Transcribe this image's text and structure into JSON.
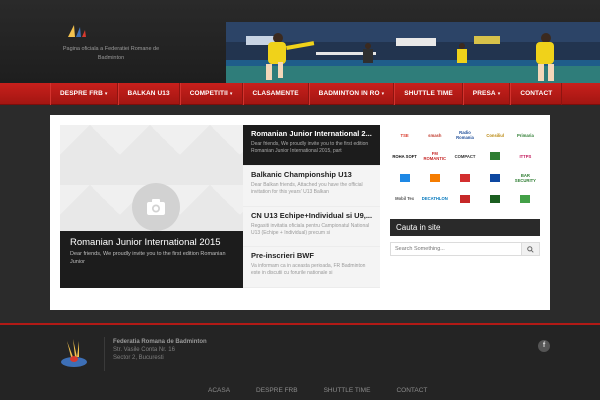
{
  "header": {
    "tagline": "Pagina oficiala a Federatiei Romane de Badminton"
  },
  "nav": {
    "items": [
      {
        "label": "DESPRE FRB",
        "dropdown": true
      },
      {
        "label": "BALKAN U13",
        "dropdown": false
      },
      {
        "label": "COMPETITII",
        "dropdown": true
      },
      {
        "label": "CLASAMENTE",
        "dropdown": false
      },
      {
        "label": "BADMINTON IN RO",
        "dropdown": true
      },
      {
        "label": "SHUTTLE TIME",
        "dropdown": false
      },
      {
        "label": "PRESA",
        "dropdown": true
      },
      {
        "label": "CONTACT",
        "dropdown": false
      }
    ],
    "caret": "▾"
  },
  "feature": {
    "title": "Romanian Junior International 2015",
    "excerpt": "Dear friends, We proudly invite you to the first edition Romanian Junior"
  },
  "posts": [
    {
      "title": "Romanian Junior International 2...",
      "excerpt": "Dear friends, We proudly invite you to the first edition Romanian Junior International 2015, part"
    },
    {
      "title": "Balkanic Championship U13",
      "excerpt": "Dear Balkan friends, Attached you have the official invitation for this years' U13 Balkan"
    },
    {
      "title": "CN U13 Echipe+Individual si U9,...",
      "excerpt": "Regasiti invitatia oficiala pentru Campionatul National U13 (Echipe + Individual) precum si"
    },
    {
      "title": "Pre-inscrieri BWF",
      "excerpt": "Va informam ca in aceasta perioada, FR Badminton este in discutii cu forurile nationale si"
    }
  ],
  "sponsors": [
    {
      "label": "TSE",
      "color": "#d93a2b"
    },
    {
      "label": "smash",
      "color": "#c0392b"
    },
    {
      "label": "Radio Romania",
      "color": "#1f4e99"
    },
    {
      "label": "Consiliul",
      "color": "#b8860b"
    },
    {
      "label": "Primaria",
      "color": "#2e7d32"
    },
    {
      "label": "ROHA SOFT",
      "color": "#111111"
    },
    {
      "label": "FM ROMANTIC",
      "color": "#c62828"
    },
    {
      "label": "COMPACT",
      "color": "#333333"
    },
    {
      "label": "",
      "color": "#2e7d32"
    },
    {
      "label": "ITTPS",
      "color": "#c2185b"
    },
    {
      "label": "",
      "color": "#1e88e5"
    },
    {
      "label": "",
      "color": "#f57c00"
    },
    {
      "label": "",
      "color": "#d32f2f"
    },
    {
      "label": "",
      "color": "#0d47a1"
    },
    {
      "label": "BAR SECURITY",
      "color": "#2e7d32"
    },
    {
      "label": "Mobil Tex",
      "color": "#555555"
    },
    {
      "label": "DECATHLON",
      "color": "#0277bd"
    },
    {
      "label": "",
      "color": "#c62828"
    },
    {
      "label": "",
      "color": "#1b5e20"
    },
    {
      "label": "",
      "color": "#43a047"
    }
  ],
  "search": {
    "title": "Cauta in site",
    "placeholder": "Search Something...",
    "button_icon": "search-icon"
  },
  "footer": {
    "org_name": "Federatia Romana de Badminton",
    "street": "Str. Vasile Conta Nr. 16",
    "city": "Sector 2, Bucuresti",
    "social_icon": "facebook-icon",
    "nav": [
      "ACASA",
      "DESPRE FRB",
      "SHUTTLE TIME",
      "CONTACT"
    ]
  },
  "colors": {
    "accent": "#c8201c",
    "background": "#2b2b2b",
    "dark_panel": "#1c1c1c"
  }
}
